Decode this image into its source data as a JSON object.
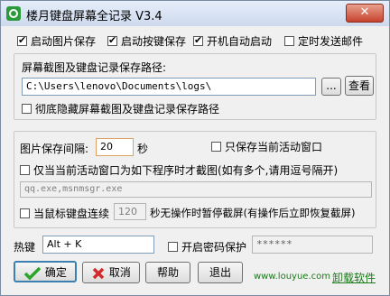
{
  "window": {
    "title": "楼月键盘屏幕全记录 V3.4",
    "close_glyph": "✕"
  },
  "options": {
    "auto_screenshot": {
      "label": "启动图片保存",
      "checked": true
    },
    "auto_keylog": {
      "label": "启动按键保存",
      "checked": true
    },
    "autostart": {
      "label": "开机自动启动",
      "checked": true
    },
    "timed_email": {
      "label": "定时发送邮件",
      "checked": false
    }
  },
  "save_path": {
    "label": "屏幕截图及键盘记录保存路径:",
    "value": "C:\\Users\\lenovo\\Documents\\logs\\",
    "browse_label": "...",
    "view_label": "查看",
    "hide_label": "彻底隐藏屏幕截图及键盘记录保存路径",
    "hide_checked": false
  },
  "interval": {
    "label": "图片保存间隔:",
    "value": "20",
    "unit": "秒",
    "active_only_label": "只保存当前活动窗口",
    "active_only_checked": false
  },
  "program_filter": {
    "label": "仅当当前活动窗口为如下程序时才截图(如有多个,请用逗号隔开)",
    "checked": false,
    "placeholder": "qq.exe,msnmsgr.exe"
  },
  "idle": {
    "label_pre": "当鼠标键盘连续",
    "value": "120",
    "label_post": "秒无操作时暂停截屏(有操作后立即恢复截屏)",
    "checked": false
  },
  "hotkey": {
    "label": "热键",
    "value": "Alt + K",
    "password_label": "开启密码保护",
    "password_checked": false,
    "password_value": "******"
  },
  "footer": {
    "ok_label": "确定",
    "cancel_label": "取消",
    "help_label": "帮助",
    "exit_label": "退出",
    "site": "www.louyue.com",
    "uninstall_label": "卸载软件"
  },
  "colors": {
    "link": "#1a7a1a",
    "ok_check": "#2aa52a",
    "cancel_x": "#d22b2b",
    "interval_border": "#e0a060"
  }
}
